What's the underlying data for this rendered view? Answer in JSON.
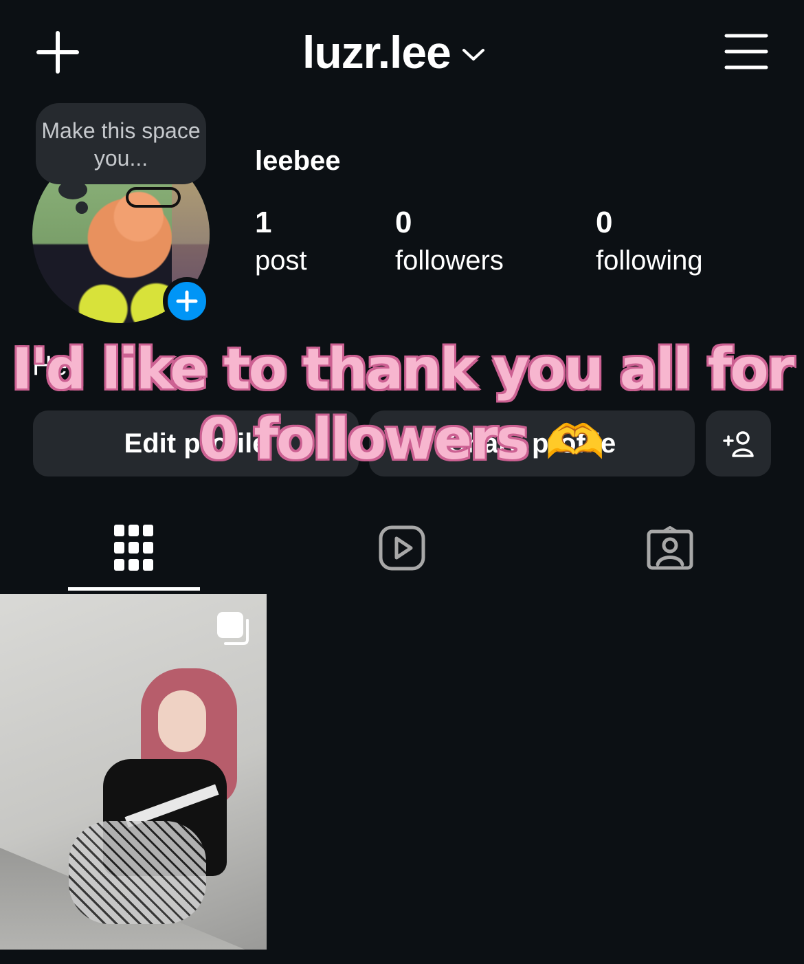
{
  "header": {
    "username": "luzr.lee",
    "new_post_icon": "plus-icon",
    "account_switch_icon": "chevron-down-icon",
    "menu_icon": "hamburger-menu-icon"
  },
  "profile": {
    "tooltip": "Make this space you...",
    "display_name": "leebee",
    "avatar_add_icon": "plus-icon",
    "stats": [
      {
        "value": "1",
        "label": "post"
      },
      {
        "value": "0",
        "label": "followers"
      },
      {
        "value": "0",
        "label": "following"
      }
    ],
    "bio_partial": "He"
  },
  "buttons": {
    "edit_profile": "Edit profile",
    "share_profile": "Share profile",
    "discover_people_icon": "add-person-icon"
  },
  "overlay": {
    "line1": "I'd like to thank you all for",
    "line2": "0 followers",
    "emoji": "🫶"
  },
  "tabs": [
    {
      "name": "posts",
      "icon": "grid-icon",
      "active": true
    },
    {
      "name": "reels",
      "icon": "reels-icon",
      "active": false
    },
    {
      "name": "tagged",
      "icon": "tagged-icon",
      "active": false
    }
  ],
  "posts": [
    {
      "type": "carousel",
      "icon": "carousel-icon"
    }
  ],
  "colors": {
    "background": "#0c1014",
    "button": "#25292e",
    "accent_blue": "#0095f6",
    "caption_fill": "#f7b6cf",
    "caption_stroke": "#cc6192"
  }
}
